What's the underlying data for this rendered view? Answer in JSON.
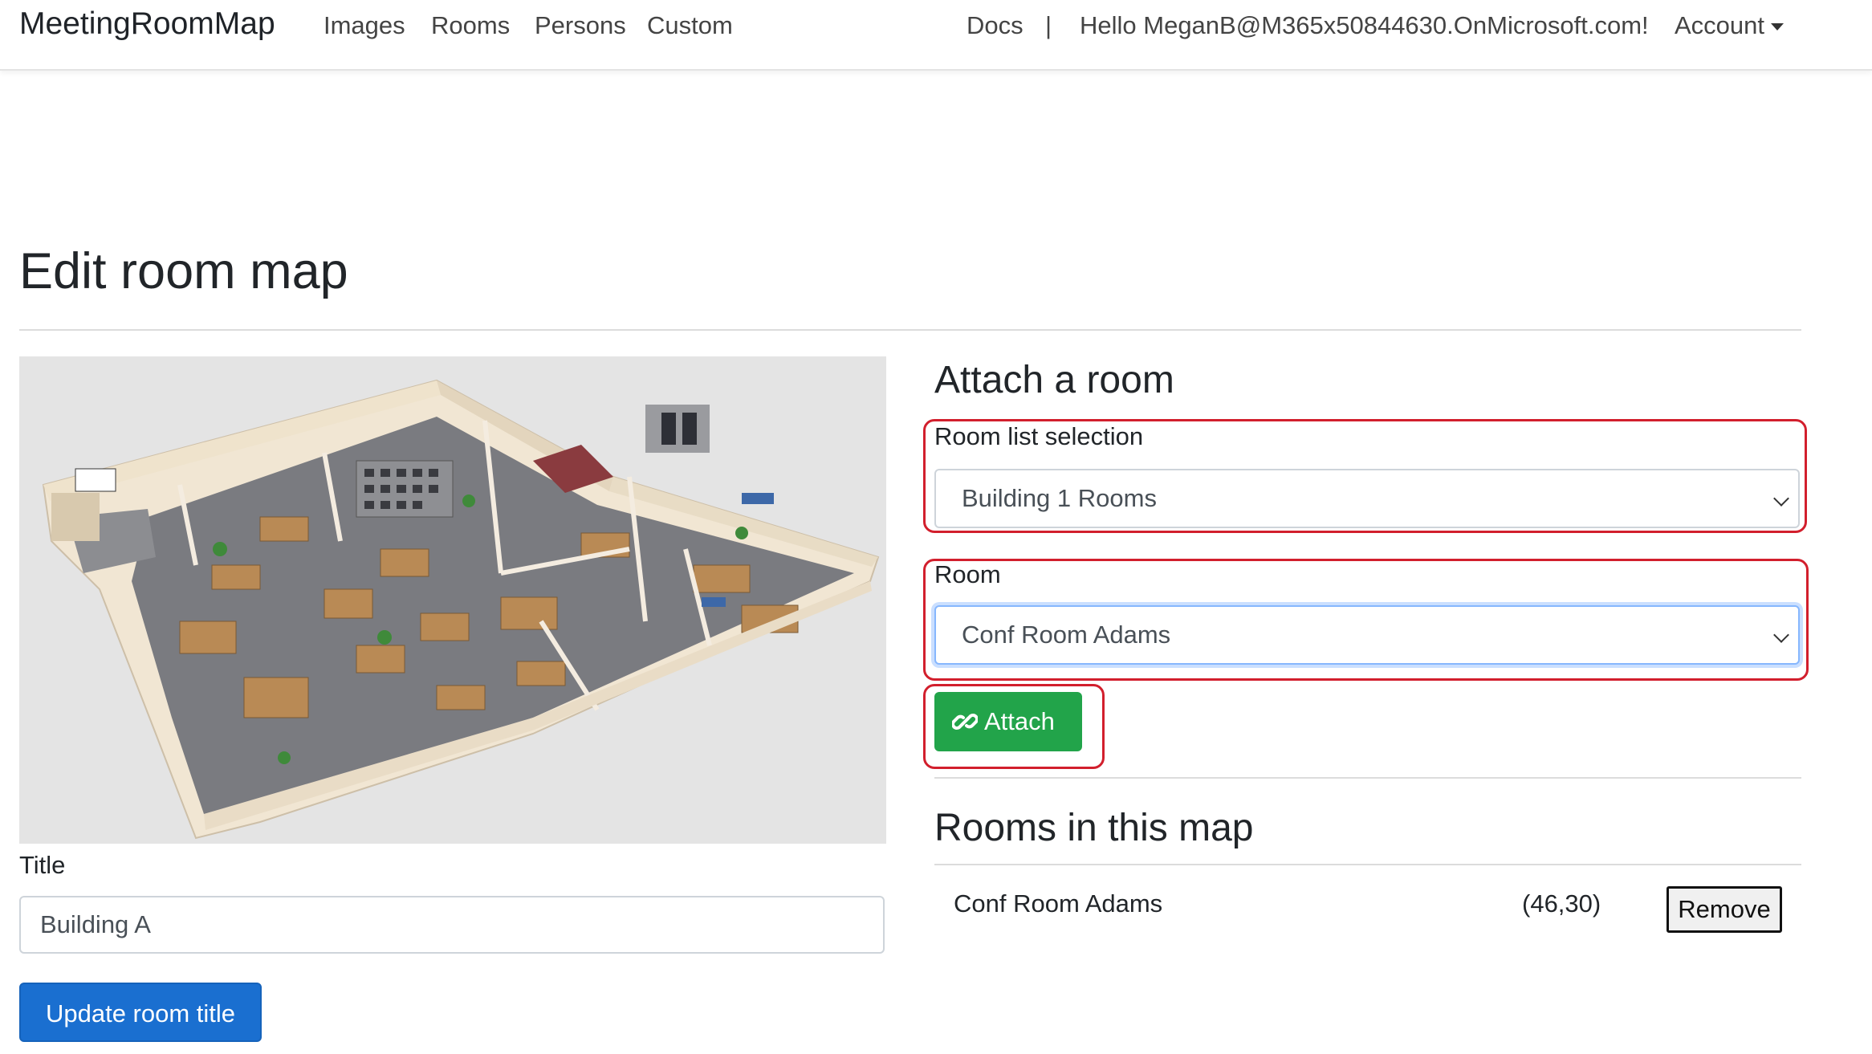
{
  "navbar": {
    "brand": "MeetingRoomMap",
    "links": [
      "Images",
      "Rooms",
      "Persons",
      "Custom"
    ],
    "docs": "Docs",
    "separator": "|",
    "greeting": "Hello MeganB@M365x50844630.OnMicrosoft.com!",
    "account": "Account"
  },
  "page": {
    "title": "Edit room map"
  },
  "left": {
    "title_label": "Title",
    "title_value": "Building A",
    "update_button": "Update room title"
  },
  "attach": {
    "heading": "Attach a room",
    "room_list_label": "Room list selection",
    "room_list_value": "Building 1 Rooms",
    "room_label": "Room",
    "room_value": "Conf Room Adams",
    "attach_button": "Attach"
  },
  "rooms_in_map": {
    "heading": "Rooms in this map",
    "items": [
      {
        "name": "Conf Room Adams",
        "coords": "(46,30)",
        "remove_label": "Remove"
      }
    ]
  },
  "colors": {
    "primary": "#1a6fd0",
    "success": "#22a44a",
    "highlight": "#d21f2d"
  }
}
